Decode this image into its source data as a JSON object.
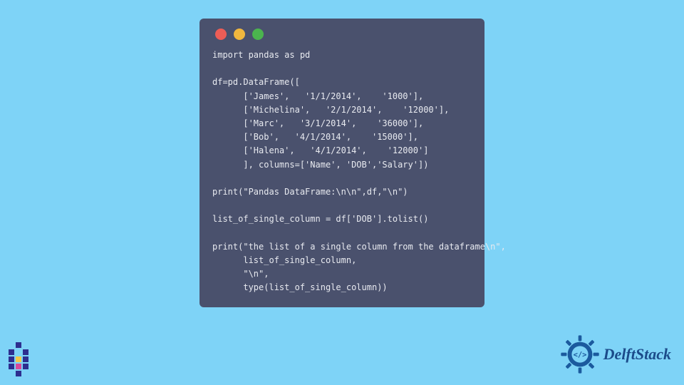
{
  "code_window": {
    "lines": [
      "import pandas as pd",
      "",
      "df=pd.DataFrame([",
      "      ['James',   '1/1/2014',    '1000'],",
      "      ['Michelina',   '2/1/2014',    '12000'],",
      "      ['Marc',   '3/1/2014',    '36000'],",
      "      ['Bob',   '4/1/2014',    '15000'],",
      "      ['Halena',   '4/1/2014',    '12000']",
      "      ], columns=['Name', 'DOB','Salary'])",
      "",
      "print(\"Pandas DataFrame:\\n\\n\",df,\"\\n\")",
      "",
      "list_of_single_column = df['DOB'].tolist()",
      "",
      "print(\"the list of a single column from the dataframe\\n\",",
      "      list_of_single_column,",
      "      \"\\n\",",
      "      type(list_of_single_column))"
    ]
  },
  "brand": {
    "name": "DelftStack"
  },
  "colors": {
    "background": "#7ed3f7",
    "window": "#4a516d",
    "code_text": "#e8eaf0",
    "brand_text": "#1b4b8a"
  }
}
